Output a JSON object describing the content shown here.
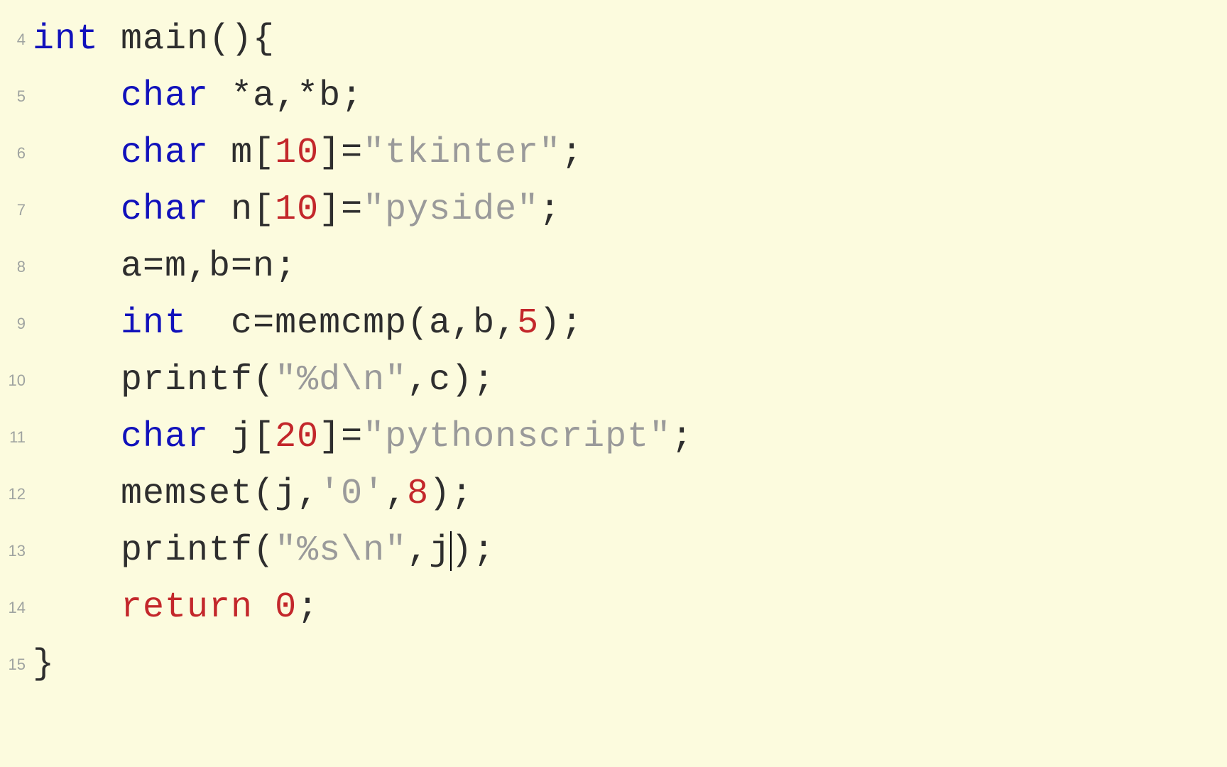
{
  "editor": {
    "gutter": [
      "4",
      "5",
      "6",
      "7",
      "8",
      "9",
      "10",
      "11",
      "12",
      "13",
      "14",
      "15"
    ],
    "cursor_line_index": 9,
    "lines": [
      [
        {
          "cls": "tok-kw",
          "t": "int"
        },
        {
          "cls": "tok-id",
          "t": " main"
        },
        {
          "cls": "tok-punc",
          "t": "(){"
        }
      ],
      [
        {
          "cls": "tok-punc",
          "t": "    "
        },
        {
          "cls": "tok-kw",
          "t": "char"
        },
        {
          "cls": "tok-punc",
          "t": " *a,*b;"
        }
      ],
      [
        {
          "cls": "tok-punc",
          "t": "    "
        },
        {
          "cls": "tok-kw",
          "t": "char"
        },
        {
          "cls": "tok-id",
          "t": " m"
        },
        {
          "cls": "tok-punc",
          "t": "["
        },
        {
          "cls": "tok-num",
          "t": "10"
        },
        {
          "cls": "tok-punc",
          "t": "]="
        },
        {
          "cls": "tok-str",
          "t": "\"tkinter\""
        },
        {
          "cls": "tok-punc",
          "t": ";"
        }
      ],
      [
        {
          "cls": "tok-punc",
          "t": "    "
        },
        {
          "cls": "tok-kw",
          "t": "char"
        },
        {
          "cls": "tok-id",
          "t": " n"
        },
        {
          "cls": "tok-punc",
          "t": "["
        },
        {
          "cls": "tok-num",
          "t": "10"
        },
        {
          "cls": "tok-punc",
          "t": "]="
        },
        {
          "cls": "tok-str",
          "t": "\"pyside\""
        },
        {
          "cls": "tok-punc",
          "t": ";"
        }
      ],
      [
        {
          "cls": "tok-punc",
          "t": "    a=m,b=n;"
        }
      ],
      [
        {
          "cls": "tok-punc",
          "t": "    "
        },
        {
          "cls": "tok-kw",
          "t": "int"
        },
        {
          "cls": "tok-id",
          "t": "  c"
        },
        {
          "cls": "tok-punc",
          "t": "=memcmp(a,b,"
        },
        {
          "cls": "tok-num",
          "t": "5"
        },
        {
          "cls": "tok-punc",
          "t": ");"
        }
      ],
      [
        {
          "cls": "tok-id",
          "t": "    printf"
        },
        {
          "cls": "tok-punc",
          "t": "("
        },
        {
          "cls": "tok-str",
          "t": "\"%d\\n\""
        },
        {
          "cls": "tok-punc",
          "t": ",c);"
        }
      ],
      [
        {
          "cls": "tok-punc",
          "t": "    "
        },
        {
          "cls": "tok-kw",
          "t": "char"
        },
        {
          "cls": "tok-id",
          "t": " j"
        },
        {
          "cls": "tok-punc",
          "t": "["
        },
        {
          "cls": "tok-num",
          "t": "20"
        },
        {
          "cls": "tok-punc",
          "t": "]="
        },
        {
          "cls": "tok-str",
          "t": "\"pythonscript\""
        },
        {
          "cls": "tok-punc",
          "t": ";"
        }
      ],
      [
        {
          "cls": "tok-id",
          "t": "    memset"
        },
        {
          "cls": "tok-punc",
          "t": "(j,"
        },
        {
          "cls": "tok-str",
          "t": "'0'"
        },
        {
          "cls": "tok-punc",
          "t": ","
        },
        {
          "cls": "tok-num",
          "t": "8"
        },
        {
          "cls": "tok-punc",
          "t": ");"
        }
      ],
      [
        {
          "cls": "tok-id",
          "t": "    printf"
        },
        {
          "cls": "tok-punc",
          "t": "("
        },
        {
          "cls": "tok-str",
          "t": "\"%s\\n\""
        },
        {
          "cls": "tok-punc",
          "t": ",j"
        },
        {
          "cls": "cursor",
          "t": ""
        },
        {
          "cls": "tok-punc",
          "t": ");"
        }
      ],
      [
        {
          "cls": "tok-punc",
          "t": "    "
        },
        {
          "cls": "tok-ret",
          "t": "return"
        },
        {
          "cls": "tok-punc",
          "t": " "
        },
        {
          "cls": "tok-num",
          "t": "0"
        },
        {
          "cls": "tok-punc",
          "t": ";"
        }
      ],
      [
        {
          "cls": "tok-punc",
          "t": "}"
        }
      ]
    ]
  }
}
